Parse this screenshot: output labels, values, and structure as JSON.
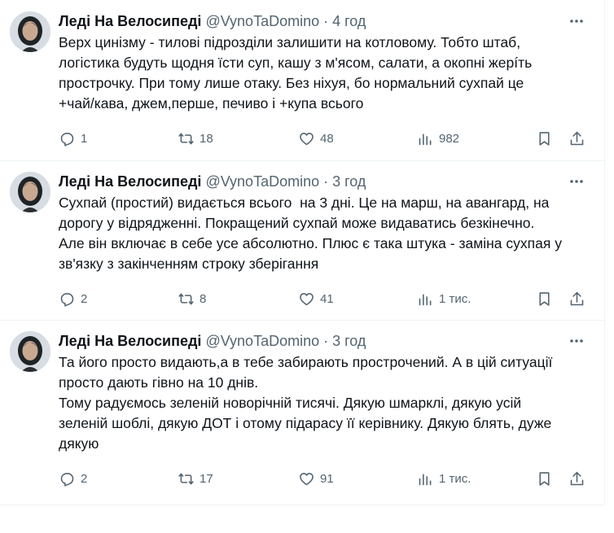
{
  "tweets": [
    {
      "name": "Леді На Велосипеді",
      "handle": "@VynoTaDomino",
      "separator": "·",
      "time": "4 год",
      "text": "Верх цинізму - тилові підрозділи залишити на котловому. Тобто штаб,\nлогістика будуть щодня їсти суп, кашу з м'ясом, салати, а окопні жерíть\nпрострочку. При тому лише отаку. Без ніхуя, бо нормальний сухпай це\n+чай/кава, джем,перше, печиво і +купа всього",
      "replies": "1",
      "reposts": "18",
      "likes": "48",
      "views": "982"
    },
    {
      "name": "Леді На Велосипеді",
      "handle": "@VynoTaDomino",
      "separator": "·",
      "time": "3 год",
      "text": "Сухпай (простий) видається всього  на 3 дні. Це на марш, на авангард, на\nдорогу у відрядженні. Покращений сухпай може видаватись безкінечно.\nАле він включає в себе усе абсолютно. Плюс є така штука - заміна сухпая у\nзв'язку з закінченням строку зберігання",
      "replies": "2",
      "reposts": "8",
      "likes": "41",
      "views": "1 тис."
    },
    {
      "name": "Леді На Велосипеді",
      "handle": "@VynoTaDomino",
      "separator": "·",
      "time": "3 год",
      "text": "Та його просто видають,а в тебе забирають прострочений. А в цій ситуації\nпросто дають гівно на 10 днів.\nТому радуємось зеленій новорічній тисячі. Дякую шмарклі, дякую усій\nзеленій шоблі, дякую ДОТ і отому підарасу її керівнику. Дякую блять, дуже\nдякую",
      "replies": "2",
      "reposts": "17",
      "likes": "91",
      "views": "1 тис."
    }
  ],
  "colors": {
    "text": "#0f1419",
    "secondary": "#536471",
    "divider": "#eff3f4"
  }
}
